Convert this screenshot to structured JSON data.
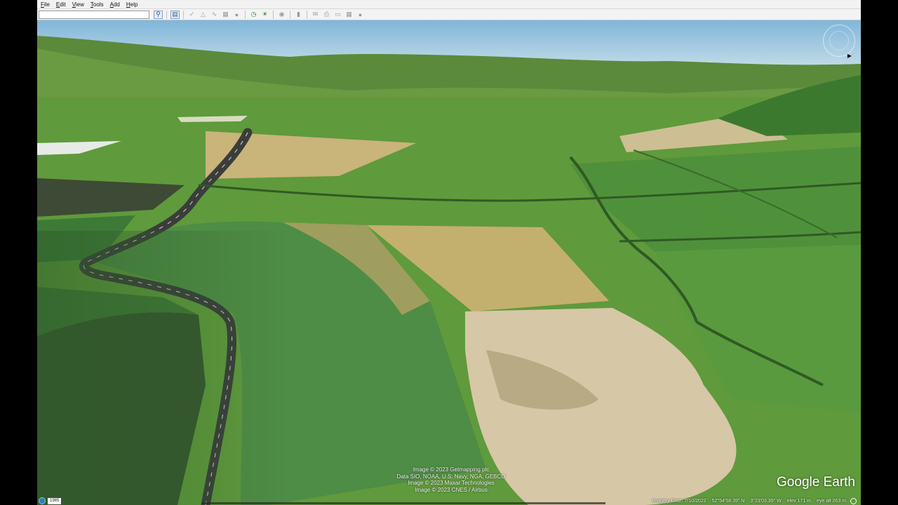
{
  "menu": {
    "items": [
      "File",
      "Edit",
      "View",
      "Tools",
      "Add",
      "Help"
    ]
  },
  "toolbar": {
    "search_value": "",
    "buttons": [
      {
        "icon": "search-icon"
      },
      {
        "icon": "sidebar-toggle-icon"
      },
      {
        "icon": "placemark-icon"
      },
      {
        "icon": "polygon-icon"
      },
      {
        "icon": "path-icon"
      },
      {
        "icon": "image-overlay-icon"
      },
      {
        "icon": "record-tour-icon"
      },
      {
        "icon": "historical-imagery-icon"
      },
      {
        "icon": "sunlight-icon"
      },
      {
        "icon": "planet-icon"
      },
      {
        "icon": "ruler-icon"
      },
      {
        "icon": "email-icon"
      },
      {
        "icon": "print-icon"
      },
      {
        "icon": "save-image-icon"
      },
      {
        "icon": "view-in-maps-icon"
      },
      {
        "icon": "settings-icon"
      }
    ]
  },
  "view": {
    "attribution": [
      "Image © 2023 Getmapping plc",
      "Data SIO, NOAA, U.S. Navy, NGA, GEBCO",
      "Image © 2023 Maxar Technologies",
      "Image © 2023 CNES / Airbus"
    ],
    "brand": "Google Earth"
  },
  "status": {
    "year": "1985",
    "imagery_date": "Imagery Date: 7/10/2022",
    "latitude": "52°54'58.39\" N",
    "longitude": "3°23'03.39\" W",
    "elevation": "elev  171 m",
    "eye_alt": "eye alt  263 m"
  },
  "colors": {
    "sky_top": "#7fb6d9",
    "sky_horizon": "#c5dde8",
    "field_green": "#4f8f35",
    "field_light": "#79a84a",
    "hay_field": "#c9b47a",
    "road": "#3a3d3a",
    "quarry": "#d6c7a6"
  }
}
